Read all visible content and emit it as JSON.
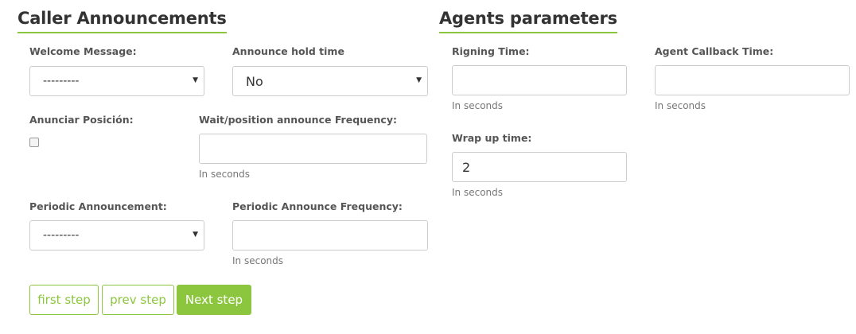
{
  "caller": {
    "title": "Caller Announcements",
    "welcome": {
      "label": "Welcome Message:",
      "value": "---------"
    },
    "hold": {
      "label": "Announce hold time",
      "value": "No"
    },
    "position": {
      "label": "Anunciar Posición:",
      "checked": false
    },
    "frequency": {
      "label": "Wait/position announce Frequency:",
      "value": "",
      "help": "In seconds"
    },
    "periodic": {
      "label": "Periodic Announcement:",
      "value": "---------"
    },
    "periodic_freq": {
      "label": "Periodic Announce Frequency:",
      "value": "",
      "help": "In seconds"
    }
  },
  "agents": {
    "title": "Agents parameters",
    "ring": {
      "label": "Rigning Time:",
      "value": "",
      "help": "In seconds"
    },
    "callback": {
      "label": "Agent Callback Time:",
      "value": "",
      "help": "In seconds"
    },
    "wrapup": {
      "label": "Wrap up time:",
      "value": "2",
      "help": "In seconds"
    }
  },
  "buttons": {
    "first": "first step",
    "prev": "prev step",
    "next": "Next step"
  },
  "colors": {
    "accent": "#8cc63f",
    "border": "#cccccc"
  }
}
